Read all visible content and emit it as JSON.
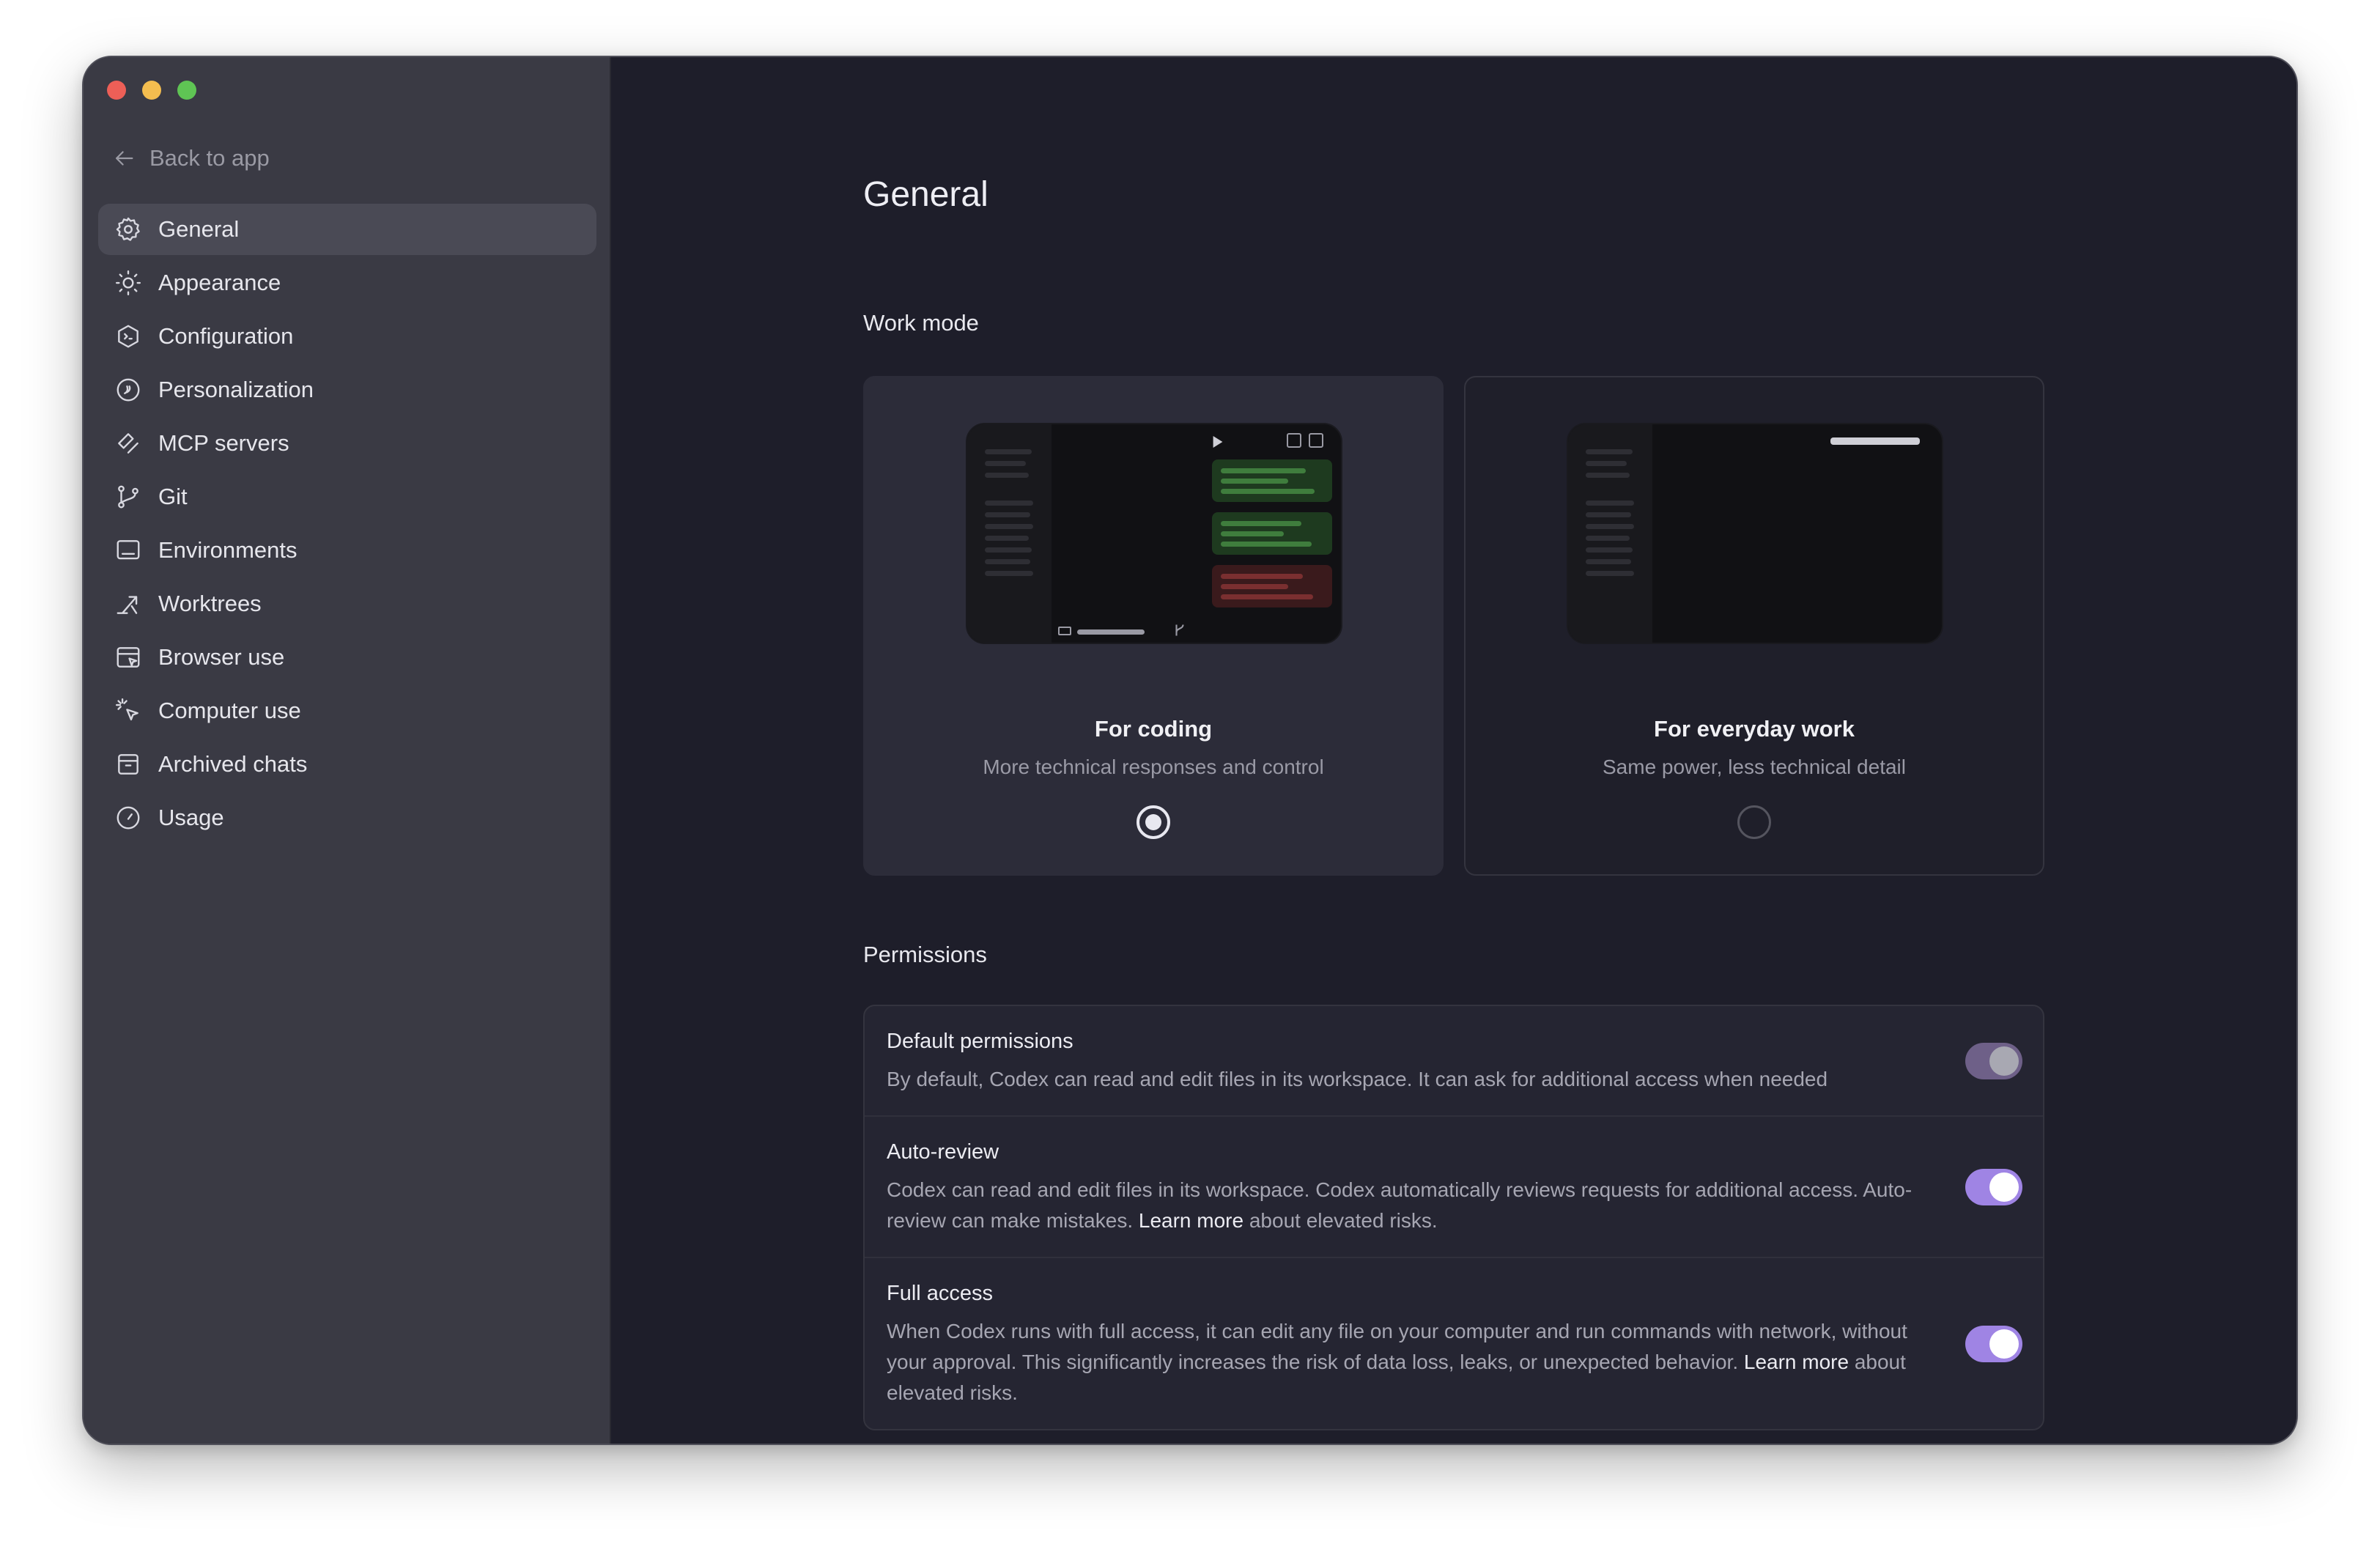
{
  "sidebar": {
    "back_label": "Back to app",
    "items": [
      {
        "label": "General",
        "icon": "gear-icon",
        "active": true
      },
      {
        "label": "Appearance",
        "icon": "sun-icon"
      },
      {
        "label": "Configuration",
        "icon": "config-icon"
      },
      {
        "label": "Personalization",
        "icon": "personalization-icon"
      },
      {
        "label": "MCP servers",
        "icon": "mcp-icon"
      },
      {
        "label": "Git",
        "icon": "git-branch-icon"
      },
      {
        "label": "Environments",
        "icon": "monitor-icon"
      },
      {
        "label": "Worktrees",
        "icon": "worktree-icon"
      },
      {
        "label": "Browser use",
        "icon": "browser-icon"
      },
      {
        "label": "Computer use",
        "icon": "cursor-sparkle-icon"
      },
      {
        "label": "Archived chats",
        "icon": "archive-icon"
      },
      {
        "label": "Usage",
        "icon": "gauge-icon"
      }
    ]
  },
  "main": {
    "title": "General",
    "work_mode": {
      "heading": "Work mode",
      "options": [
        {
          "title": "For coding",
          "subtitle": "More technical responses and control",
          "selected": true
        },
        {
          "title": "For everyday work",
          "subtitle": "Same power, less technical detail",
          "selected": false
        }
      ]
    },
    "permissions": {
      "heading": "Permissions",
      "rows": [
        {
          "name": "Default permissions",
          "desc": "By default, Codex can read and edit files in its workspace. It can ask for additional access when needed",
          "enabled": true,
          "disabled": true
        },
        {
          "name": "Auto-review",
          "desc_before": "Codex can read and edit files in its workspace. Codex automatically reviews requests for additional access. Auto-review can make mistakes. ",
          "link": "Learn more",
          "desc_after": " about elevated risks.",
          "enabled": true
        },
        {
          "name": "Full access",
          "desc_before": "When Codex runs with full access, it can edit any file on your computer and run commands with network, without your approval. This significantly increases the risk of data loss, leaks, or unexpected behavior. ",
          "link": "Learn more",
          "desc_after": " about elevated risks.",
          "enabled": true
        }
      ]
    }
  },
  "colors": {
    "accent": "#9f84e4",
    "sidebar_bg": "#3a3a44",
    "main_bg": "#1e1e2a"
  }
}
